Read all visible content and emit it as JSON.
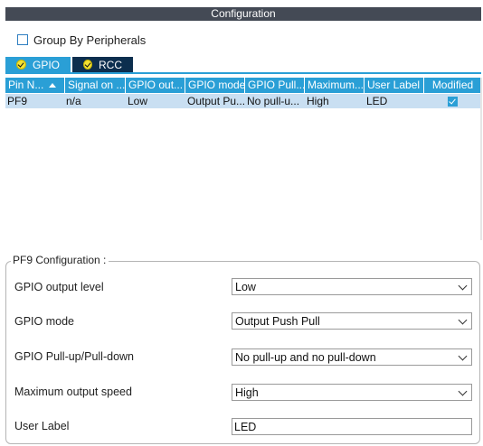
{
  "panel": {
    "title": "Configuration"
  },
  "group_by": {
    "label": "Group By Peripherals",
    "checked": false
  },
  "tabs": [
    {
      "label": "GPIO",
      "icon": "check-circle-icon",
      "active": true
    },
    {
      "label": "RCC",
      "icon": "check-circle-icon",
      "active": false
    }
  ],
  "table": {
    "columns": [
      "Pin N...",
      "Signal on ...",
      "GPIO out...",
      "GPIO mode",
      "GPIO Pull...",
      "Maximum...",
      "User Label",
      "Modified"
    ],
    "rows": [
      {
        "pin": "PF9",
        "signal": "n/a",
        "output": "Low",
        "mode": "Output Pu...",
        "pull": "No pull-u...",
        "speed": "High",
        "label": "LED",
        "modified": true
      }
    ]
  },
  "config": {
    "legend": "PF9 Configuration :",
    "fields": [
      {
        "label": "GPIO output level",
        "value": "Low"
      },
      {
        "label": "GPIO mode",
        "value": "Output Push Pull"
      },
      {
        "label": "GPIO Pull-up/Pull-down",
        "value": "No pull-up and no pull-down"
      },
      {
        "label": "Maximum output speed",
        "value": "High"
      }
    ],
    "user_label": {
      "label": "User Label",
      "value": "LED"
    }
  },
  "colors": {
    "accent": "#2a9fd6",
    "header": "#444a55",
    "selected_row": "#c9dff2",
    "dark_tab": "#0c2e4e"
  }
}
